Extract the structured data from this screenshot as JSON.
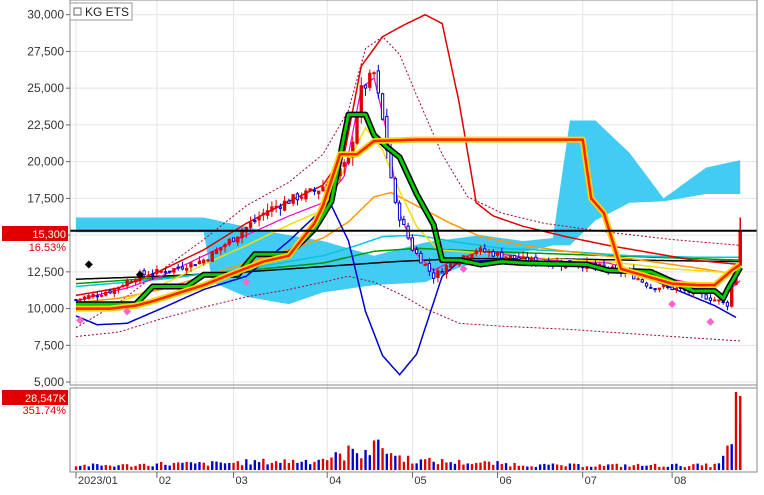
{
  "symbol": {
    "name": "KG ETS",
    "checkbox_checked": false
  },
  "current_price": {
    "label": "15,300",
    "change_pct": "16.53%",
    "value": 15300,
    "badge_color": "#e00000"
  },
  "volume_panel": {
    "label": "28,547K",
    "change_pct": "351.74%",
    "badge_color": "#e00000"
  },
  "colors": {
    "up": "#e00000",
    "down": "#0000cc",
    "cloud": "#2ec6f2",
    "highlight_band": "#ffd200",
    "band_outline": "#00cc00"
  },
  "chart_data": {
    "type": "candlestick-with-overlays",
    "ylim": [
      4800,
      31000
    ],
    "y_ticks": [
      5000,
      7500,
      10000,
      12500,
      15000,
      17500,
      20000,
      22500,
      25000,
      27500,
      30000
    ],
    "y_tick_labels": [
      "5,000",
      "7,500",
      "10,000",
      "12,500",
      "15,000",
      "17,500",
      "20,000",
      "22,500",
      "25,000",
      "27,500",
      "30,000"
    ],
    "x_labels": [
      {
        "label": "2023/01",
        "day": 0
      },
      {
        "label": "02",
        "day": 19
      },
      {
        "label": "03",
        "day": 37
      },
      {
        "label": "04",
        "day": 59
      },
      {
        "label": "05",
        "day": 79
      },
      {
        "label": "06",
        "day": 99
      },
      {
        "label": "07",
        "day": 119
      },
      {
        "label": "08",
        "day": 140
      }
    ],
    "n_days": 160,
    "close_anchor": [
      [
        0,
        10600
      ],
      [
        8,
        11200
      ],
      [
        15,
        12300
      ],
      [
        22,
        12600
      ],
      [
        30,
        13300
      ],
      [
        37,
        14800
      ],
      [
        45,
        16700
      ],
      [
        52,
        17600
      ],
      [
        57,
        18100
      ],
      [
        60,
        18700
      ],
      [
        64,
        20000
      ],
      [
        67,
        24800
      ],
      [
        70,
        26000
      ],
      [
        72,
        22800
      ],
      [
        75,
        17000
      ],
      [
        79,
        14100
      ],
      [
        84,
        12200
      ],
      [
        89,
        13300
      ],
      [
        94,
        14000
      ],
      [
        99,
        13700
      ],
      [
        105,
        13300
      ],
      [
        112,
        13100
      ],
      [
        119,
        13000
      ],
      [
        125,
        12700
      ],
      [
        130,
        12400
      ],
      [
        135,
        11500
      ],
      [
        140,
        11400
      ],
      [
        145,
        11100
      ],
      [
        150,
        10600
      ],
      [
        153,
        10300
      ],
      [
        155,
        13100
      ],
      [
        156,
        15300
      ]
    ],
    "volume_anchor": [
      [
        0,
        6
      ],
      [
        12,
        6
      ],
      [
        20,
        8
      ],
      [
        30,
        8
      ],
      [
        40,
        10
      ],
      [
        55,
        12
      ],
      [
        62,
        18
      ],
      [
        67,
        22
      ],
      [
        72,
        30
      ],
      [
        75,
        18
      ],
      [
        80,
        12
      ],
      [
        90,
        10
      ],
      [
        100,
        8
      ],
      [
        110,
        6
      ],
      [
        130,
        6
      ],
      [
        150,
        6
      ],
      [
        154,
        30
      ],
      [
        155,
        100
      ],
      [
        156,
        50
      ]
    ],
    "ma_red": [
      [
        0,
        10900
      ],
      [
        10,
        11400
      ],
      [
        20,
        12600
      ],
      [
        30,
        14000
      ],
      [
        40,
        15800
      ],
      [
        50,
        17300
      ],
      [
        58,
        18400
      ],
      [
        63,
        20500
      ],
      [
        67,
        26500
      ],
      [
        72,
        28500
      ],
      [
        77,
        29300
      ],
      [
        82,
        30000
      ],
      [
        86,
        29400
      ],
      [
        90,
        24000
      ],
      [
        94,
        17200
      ],
      [
        98,
        16300
      ],
      [
        105,
        15600
      ],
      [
        115,
        14900
      ],
      [
        125,
        14300
      ],
      [
        135,
        13800
      ],
      [
        145,
        13300
      ],
      [
        156,
        13000
      ]
    ],
    "ma_blue": [
      [
        0,
        9500
      ],
      [
        5,
        8900
      ],
      [
        12,
        9000
      ],
      [
        20,
        10000
      ],
      [
        30,
        11300
      ],
      [
        40,
        12200
      ],
      [
        50,
        14600
      ],
      [
        58,
        16800
      ],
      [
        60,
        17000
      ],
      [
        64,
        14600
      ],
      [
        68,
        9800
      ],
      [
        72,
        6800
      ],
      [
        76,
        5500
      ],
      [
        80,
        6900
      ],
      [
        86,
        12200
      ],
      [
        90,
        13200
      ],
      [
        100,
        13300
      ],
      [
        115,
        13000
      ],
      [
        130,
        12600
      ],
      [
        140,
        11400
      ],
      [
        150,
        10200
      ],
      [
        155,
        9400
      ]
    ],
    "ma_yellow": [
      [
        0,
        10300
      ],
      [
        10,
        10400
      ],
      [
        20,
        11600
      ],
      [
        30,
        13000
      ],
      [
        40,
        14300
      ],
      [
        50,
        15700
      ],
      [
        58,
        16700
      ],
      [
        64,
        20000
      ],
      [
        68,
        22300
      ],
      [
        72,
        20800
      ],
      [
        76,
        18000
      ],
      [
        80,
        15600
      ],
      [
        85,
        14000
      ],
      [
        95,
        13800
      ],
      [
        110,
        13400
      ],
      [
        125,
        13200
      ],
      [
        140,
        12700
      ],
      [
        156,
        12400
      ]
    ],
    "ma_orange": [
      [
        0,
        10400
      ],
      [
        10,
        10700
      ],
      [
        20,
        11300
      ],
      [
        30,
        12200
      ],
      [
        40,
        13100
      ],
      [
        50,
        14000
      ],
      [
        58,
        14800
      ],
      [
        64,
        15900
      ],
      [
        70,
        17600
      ],
      [
        74,
        17900
      ],
      [
        80,
        17000
      ],
      [
        88,
        15800
      ],
      [
        95,
        14900
      ],
      [
        105,
        14300
      ],
      [
        115,
        13900
      ],
      [
        130,
        13400
      ],
      [
        145,
        12800
      ],
      [
        156,
        12300
      ]
    ],
    "ma_cyan": [
      [
        0,
        11500
      ],
      [
        20,
        12000
      ],
      [
        40,
        12700
      ],
      [
        58,
        13600
      ],
      [
        66,
        14300
      ],
      [
        72,
        14900
      ],
      [
        80,
        15000
      ],
      [
        90,
        14500
      ],
      [
        100,
        14100
      ],
      [
        115,
        13900
      ],
      [
        130,
        13600
      ],
      [
        145,
        13500
      ],
      [
        156,
        13500
      ]
    ],
    "ma_green": [
      [
        0,
        11700
      ],
      [
        20,
        12100
      ],
      [
        40,
        12600
      ],
      [
        58,
        13100
      ],
      [
        70,
        13900
      ],
      [
        80,
        14100
      ],
      [
        95,
        13900
      ],
      [
        115,
        13700
      ],
      [
        135,
        13500
      ],
      [
        156,
        13300
      ]
    ],
    "ma_black": [
      [
        0,
        12000
      ],
      [
        20,
        12200
      ],
      [
        40,
        12500
      ],
      [
        60,
        12900
      ],
      [
        75,
        13200
      ],
      [
        90,
        13400
      ],
      [
        110,
        13400
      ],
      [
        130,
        13300
      ],
      [
        156,
        13200
      ]
    ],
    "ma_magenta": [
      [
        0,
        10500
      ],
      [
        6,
        11000
      ],
      [
        12,
        11400
      ],
      [
        20,
        12200
      ],
      [
        30,
        13600
      ],
      [
        40,
        15000
      ],
      [
        50,
        16300
      ],
      [
        58,
        17200
      ],
      [
        63,
        19000
      ],
      [
        67,
        25000
      ],
      [
        70,
        25700
      ],
      [
        73,
        22000
      ],
      [
        76,
        16500
      ],
      [
        80,
        13700
      ],
      [
        84,
        12600
      ],
      [
        88,
        13200
      ],
      [
        95,
        13900
      ],
      [
        105,
        13500
      ],
      [
        115,
        13200
      ],
      [
        125,
        13100
      ],
      [
        135,
        12300
      ],
      [
        145,
        11700
      ],
      [
        152,
        10900
      ],
      [
        156,
        11900
      ]
    ],
    "band_upper": [
      [
        0,
        8700
      ],
      [
        10,
        10400
      ],
      [
        20,
        12600
      ],
      [
        30,
        14700
      ],
      [
        40,
        17000
      ],
      [
        50,
        18600
      ],
      [
        58,
        20500
      ],
      [
        64,
        23500
      ],
      [
        68,
        27700
      ],
      [
        72,
        28500
      ],
      [
        76,
        27300
      ],
      [
        80,
        24500
      ],
      [
        86,
        20500
      ],
      [
        92,
        17600
      ],
      [
        100,
        16500
      ],
      [
        110,
        15800
      ],
      [
        125,
        15200
      ],
      [
        140,
        14700
      ],
      [
        156,
        14300
      ]
    ],
    "band_lower": [
      [
        0,
        8100
      ],
      [
        10,
        8400
      ],
      [
        20,
        9300
      ],
      [
        30,
        10100
      ],
      [
        40,
        10800
      ],
      [
        50,
        11300
      ],
      [
        58,
        11800
      ],
      [
        64,
        12200
      ],
      [
        70,
        11800
      ],
      [
        76,
        11000
      ],
      [
        82,
        10000
      ],
      [
        90,
        9000
      ],
      [
        100,
        8800
      ],
      [
        115,
        8600
      ],
      [
        130,
        8300
      ],
      [
        145,
        8000
      ],
      [
        156,
        7800
      ]
    ],
    "thick_line": [
      [
        0,
        10300
      ],
      [
        8,
        10300
      ],
      [
        14,
        10300
      ],
      [
        18,
        11500
      ],
      [
        26,
        11500
      ],
      [
        30,
        12300
      ],
      [
        38,
        12300
      ],
      [
        42,
        13700
      ],
      [
        50,
        13700
      ],
      [
        56,
        15400
      ],
      [
        60,
        17300
      ],
      [
        63,
        21800
      ],
      [
        64,
        23200
      ],
      [
        68,
        23200
      ],
      [
        70,
        21800
      ],
      [
        73,
        21000
      ],
      [
        76,
        20300
      ],
      [
        80,
        17800
      ],
      [
        84,
        15700
      ],
      [
        86,
        13300
      ],
      [
        90,
        13300
      ],
      [
        95,
        13000
      ],
      [
        100,
        13200
      ],
      [
        105,
        13100
      ],
      [
        120,
        13000
      ],
      [
        125,
        12600
      ],
      [
        135,
        12500
      ],
      [
        145,
        11200
      ],
      [
        150,
        11200
      ],
      [
        152,
        10700
      ],
      [
        153,
        11300
      ],
      [
        156,
        12800
      ]
    ],
    "thick_red": [
      [
        0,
        10000
      ],
      [
        8,
        10000
      ],
      [
        14,
        10200
      ],
      [
        18,
        10500
      ],
      [
        30,
        11600
      ],
      [
        36,
        12300
      ],
      [
        44,
        13200
      ],
      [
        50,
        13600
      ],
      [
        56,
        15800
      ],
      [
        58,
        17000
      ],
      [
        62,
        20500
      ],
      [
        66,
        20500
      ],
      [
        70,
        21400
      ],
      [
        80,
        21500
      ],
      [
        96,
        21500
      ],
      [
        110,
        21500
      ],
      [
        119,
        21500
      ],
      [
        121,
        17500
      ],
      [
        124,
        16500
      ],
      [
        128,
        12700
      ],
      [
        134,
        12200
      ],
      [
        140,
        11700
      ],
      [
        146,
        11600
      ],
      [
        150,
        11600
      ],
      [
        154,
        12600
      ],
      [
        156,
        13000
      ]
    ],
    "cloud_top": [
      [
        0,
        16200
      ],
      [
        30,
        16200
      ],
      [
        44,
        15300
      ],
      [
        58,
        14600
      ],
      [
        70,
        13600
      ],
      [
        82,
        14500
      ],
      [
        95,
        15000
      ],
      [
        105,
        14600
      ],
      [
        112,
        14800
      ],
      [
        116,
        22800
      ],
      [
        122,
        22800
      ],
      [
        130,
        20600
      ],
      [
        138,
        17500
      ],
      [
        148,
        19600
      ],
      [
        156,
        20100
      ]
    ],
    "cloud_bottom": [
      [
        0,
        15200
      ],
      [
        30,
        15200
      ],
      [
        32,
        11800
      ],
      [
        40,
        10800
      ],
      [
        50,
        10300
      ],
      [
        58,
        11100
      ],
      [
        70,
        11600
      ],
      [
        82,
        11800
      ],
      [
        90,
        12800
      ],
      [
        100,
        13500
      ],
      [
        112,
        14300
      ],
      [
        116,
        14300
      ],
      [
        122,
        16000
      ],
      [
        130,
        17200
      ],
      [
        138,
        17300
      ],
      [
        148,
        17800
      ],
      [
        156,
        17800
      ]
    ],
    "markers": {
      "pink_up": [
        [
          1,
          9200
        ],
        [
          12,
          9800
        ],
        [
          40,
          11800
        ],
        [
          91,
          12700
        ],
        [
          140,
          10300
        ],
        [
          149,
          9100
        ]
      ],
      "black_diamond": [
        [
          3,
          13000
        ],
        [
          15,
          12300
        ]
      ]
    }
  }
}
